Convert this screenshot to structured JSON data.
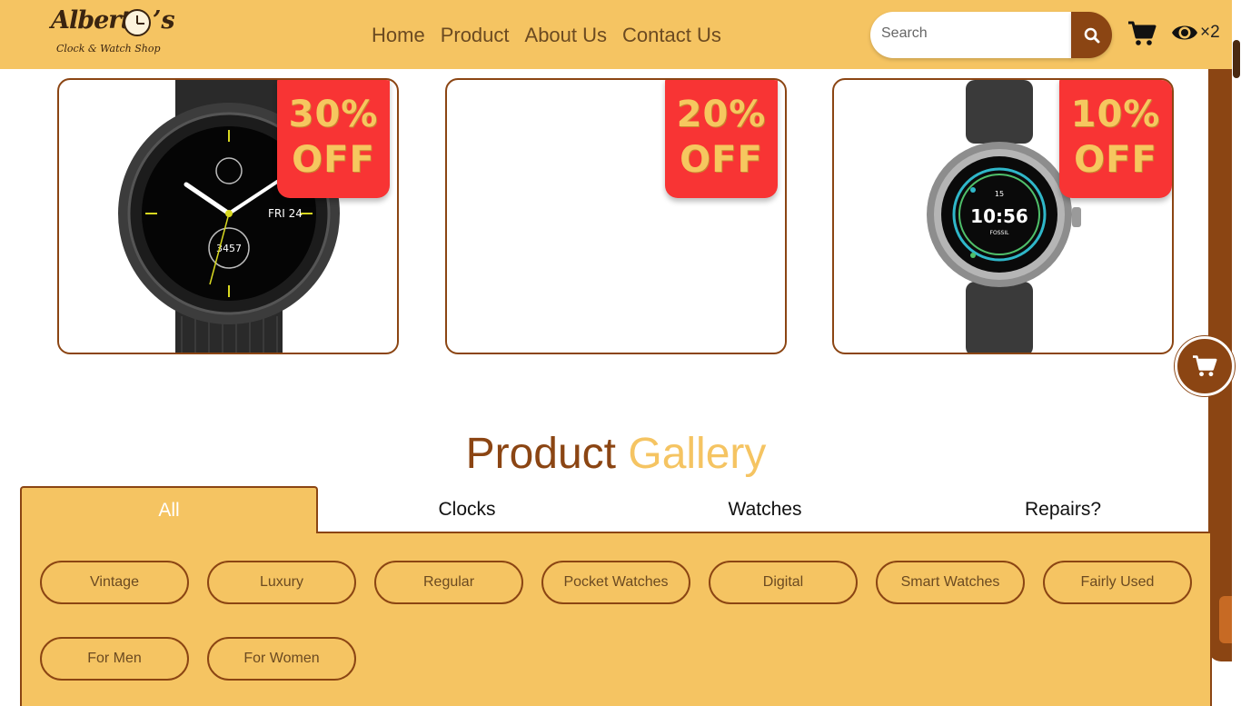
{
  "brand": {
    "name": "Albert",
    "suffix": "s",
    "tagline": "Clock & Watch Shop"
  },
  "nav": {
    "items": [
      "Home",
      "Product",
      "About Us",
      "Contact Us"
    ]
  },
  "search": {
    "placeholder": "Search"
  },
  "header_icons": {
    "eye_count": "×2"
  },
  "offers": [
    {
      "line1": "30%",
      "line2": "OFF",
      "image": "smartwatch-black-round"
    },
    {
      "line1": "20%",
      "line2": "OFF",
      "image": ""
    },
    {
      "line1": "10%",
      "line2": "OFF",
      "image": "smartwatch-fossil"
    }
  ],
  "gallery": {
    "title_word1": "Product",
    "title_word2": "Gallery",
    "tabs": [
      "All",
      "Clocks",
      "Watches",
      "Repairs?"
    ],
    "active_tab": "All",
    "filters": [
      "Vintage",
      "Luxury",
      "Regular",
      "Pocket Watches",
      "Digital",
      "Smart Watches",
      "Fairly Used",
      "For Men",
      "For Women"
    ]
  },
  "colors": {
    "accent": "#f5c462",
    "brand_brown": "#8b4513",
    "badge_red": "#f83434"
  }
}
